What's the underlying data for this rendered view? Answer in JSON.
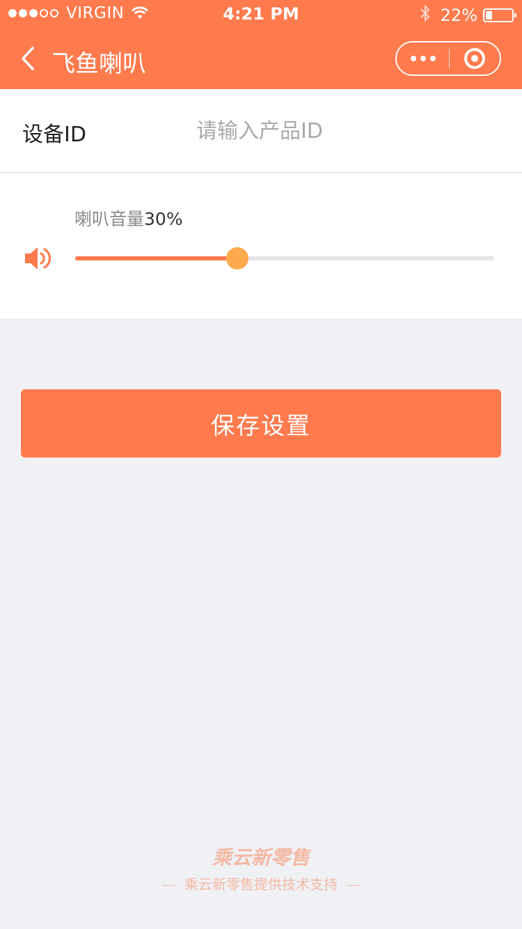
{
  "status_bar": {
    "carrier": "VIRGIN",
    "signal_bars_filled": 3,
    "signal_bars_total": 5,
    "time": "4:21 PM",
    "battery_percent": "22%",
    "icons": [
      "wifi-icon",
      "bluetooth-icon",
      "battery-icon"
    ]
  },
  "nav": {
    "title": "飞鱼喇叭",
    "back_icon": "chevron-left-icon",
    "more_icon": "more-dots-icon",
    "close_icon": "target-close-icon"
  },
  "device": {
    "label": "设备ID",
    "value": "",
    "placeholder": "请输入产品ID"
  },
  "volume": {
    "label": "喇叭音量",
    "value_text": "30%",
    "level_fraction": 0.387,
    "icon": "speaker-icon"
  },
  "actions": {
    "save_label": "保存设置"
  },
  "footer": {
    "logo_text": "乘云新零售",
    "support_text": "乘云新零售提供技术支持"
  },
  "colors": {
    "primary": "#ff7a4d",
    "slider_thumb": "#ffa94d",
    "page_bg": "#f0f1f5",
    "footer_text": "#f4b8a3"
  }
}
